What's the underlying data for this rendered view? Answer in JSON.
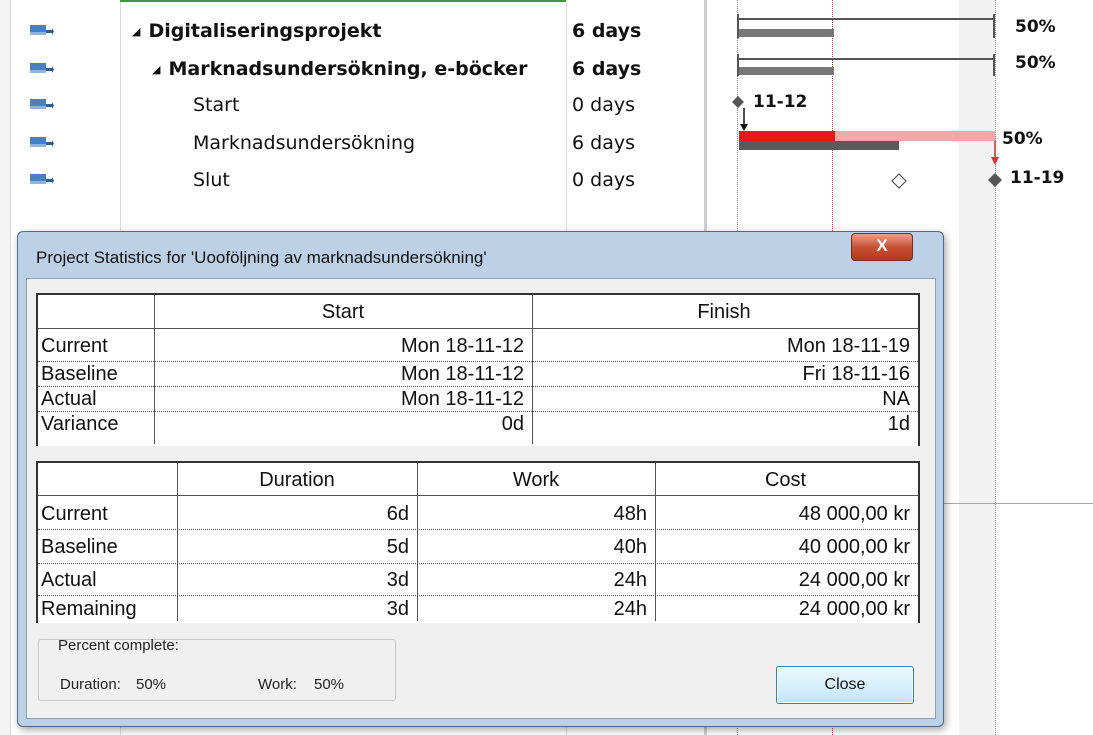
{
  "tasks": [
    {
      "name": "Digitaliseringsprojekt",
      "duration": "6 days",
      "bold": true,
      "indent": 0,
      "summary": true
    },
    {
      "name": "Marknadsundersökning, e-böcker",
      "duration": "6 days",
      "bold": true,
      "indent": 1,
      "summary": true
    },
    {
      "name": "Start",
      "duration": "0 days",
      "bold": false,
      "indent": 2,
      "summary": false
    },
    {
      "name": "Marknadsundersökning",
      "duration": "6 days",
      "bold": false,
      "indent": 2,
      "summary": false
    },
    {
      "name": "Slut",
      "duration": "0 days",
      "bold": false,
      "indent": 2,
      "summary": false
    }
  ],
  "gantt": {
    "summary1_pct": "50%",
    "summary2_pct": "50%",
    "start_date": "11-12",
    "task_pct": "50%",
    "end_date": "11-19"
  },
  "dialog": {
    "title": "Project Statistics for 'Uooföljning av marknadsundersökning'",
    "close_x": "X",
    "dates_table": {
      "headers": [
        "Start",
        "Finish"
      ],
      "rows": [
        {
          "label": "Current",
          "start": "Mon 18-11-12",
          "finish": "Mon 18-11-19"
        },
        {
          "label": "Baseline",
          "start": "Mon 18-11-12",
          "finish": "Fri 18-11-16"
        },
        {
          "label": "Actual",
          "start": "Mon 18-11-12",
          "finish": "NA"
        },
        {
          "label": "Variance",
          "start": "0d",
          "finish": "1d"
        }
      ]
    },
    "work_table": {
      "headers": [
        "Duration",
        "Work",
        "Cost"
      ],
      "rows": [
        {
          "label": "Current",
          "duration": "6d",
          "work": "48h",
          "cost": "48 000,00 kr"
        },
        {
          "label": "Baseline",
          "duration": "5d",
          "work": "40h",
          "cost": "40 000,00 kr"
        },
        {
          "label": "Actual",
          "duration": "3d",
          "work": "24h",
          "cost": "24 000,00 kr"
        },
        {
          "label": "Remaining",
          "duration": "3d",
          "work": "24h",
          "cost": "24 000,00 kr"
        }
      ]
    },
    "percent_complete": {
      "label": "Percent complete:",
      "duration_label": "Duration:",
      "duration_value": "50%",
      "work_label": "Work:",
      "work_value": "50%"
    },
    "close_button": "Close"
  },
  "colors": {
    "critical_bar": "#e8171b",
    "progress_bar": "#5a5a5a",
    "remaining_bar": "#f5a8a8",
    "mode_icon": "#4a7fc0"
  }
}
